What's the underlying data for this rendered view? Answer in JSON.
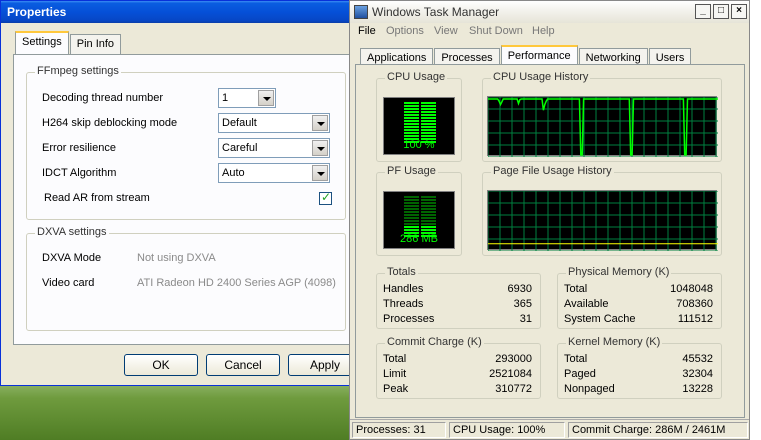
{
  "properties": {
    "title": "Properties",
    "tabs": [
      {
        "label": "Settings",
        "active": true
      },
      {
        "label": "Pin Info",
        "active": false
      }
    ],
    "ffmpeg": {
      "legend": "FFmpeg settings",
      "rows": [
        {
          "label": "Decoding thread number",
          "value": "1"
        },
        {
          "label": "H264 skip deblocking mode",
          "value": "Default"
        },
        {
          "label": "Error resilience",
          "value": "Careful"
        },
        {
          "label": "IDCT Algorithm",
          "value": "Auto"
        }
      ],
      "checkbox_label": "Read AR from stream",
      "checkbox_checked": true
    },
    "dxva": {
      "legend": "DXVA settings",
      "mode_label": "DXVA Mode",
      "mode_value": "Not using DXVA",
      "card_label": "Video card",
      "card_value": "ATI Radeon HD 2400 Series AGP (4098)"
    },
    "buttons": {
      "ok": "OK",
      "cancel": "Cancel",
      "apply": "Apply"
    }
  },
  "taskmanager": {
    "title": "Windows Task Manager",
    "menu": [
      "File",
      "Options",
      "View",
      "Shut Down",
      "Help"
    ],
    "tabs": [
      {
        "label": "Applications",
        "active": false
      },
      {
        "label": "Processes",
        "active": false
      },
      {
        "label": "Performance",
        "active": true
      },
      {
        "label": "Networking",
        "active": false
      },
      {
        "label": "Users",
        "active": false
      }
    ],
    "cpu_usage": {
      "legend": "CPU Usage",
      "value_text": "100 %",
      "level": 1.0
    },
    "cpu_history": {
      "legend": "CPU Usage History",
      "series": [
        100,
        100,
        100,
        100,
        100,
        100,
        100,
        100,
        96,
        90,
        95,
        100,
        100,
        100,
        100,
        100,
        100,
        100,
        100,
        100,
        100,
        100,
        92,
        99,
        100,
        100,
        100,
        100,
        100,
        100,
        100,
        100,
        100,
        100,
        100,
        100,
        100,
        100,
        100,
        100,
        80,
        90,
        96,
        100,
        100,
        100,
        100,
        100,
        100,
        100,
        100,
        100,
        100,
        100,
        100,
        100,
        100,
        100,
        100,
        100,
        100,
        100,
        100,
        100,
        100,
        100,
        100,
        0,
        0,
        100,
        100,
        100,
        100,
        100,
        100,
        100,
        100,
        100,
        100,
        100,
        100,
        100,
        100,
        100,
        100,
        100,
        100,
        100,
        100,
        100,
        100,
        100,
        100,
        100,
        100,
        100,
        100,
        100,
        100,
        100,
        100,
        100,
        100,
        0,
        0,
        100,
        100,
        100,
        100,
        100,
        100,
        100,
        100,
        100,
        100,
        100,
        100,
        100,
        100,
        100,
        100,
        100,
        100,
        100,
        100,
        100,
        100,
        100,
        100,
        100,
        100,
        100,
        100,
        100,
        100,
        100,
        100,
        100,
        100,
        100,
        100,
        100,
        0,
        0,
        100,
        100,
        100,
        100,
        100,
        100,
        100,
        100,
        100,
        100,
        100,
        100,
        100,
        100,
        100,
        100,
        100,
        100,
        100,
        100,
        100,
        100,
        100
      ]
    },
    "pf_usage": {
      "legend": "PF Usage",
      "value_text": "286 MB",
      "level": 0.27
    },
    "pf_history": {
      "legend": "Page File Usage History"
    },
    "totals": {
      "legend": "Totals",
      "rows": [
        {
          "label": "Handles",
          "value": "6930"
        },
        {
          "label": "Threads",
          "value": "365"
        },
        {
          "label": "Processes",
          "value": "31"
        }
      ]
    },
    "physical": {
      "legend": "Physical Memory (K)",
      "rows": [
        {
          "label": "Total",
          "value": "1048048"
        },
        {
          "label": "Available",
          "value": "708360"
        },
        {
          "label": "System Cache",
          "value": "111512"
        }
      ]
    },
    "commit": {
      "legend": "Commit Charge (K)",
      "rows": [
        {
          "label": "Total",
          "value": "293000"
        },
        {
          "label": "Limit",
          "value": "2521084"
        },
        {
          "label": "Peak",
          "value": "310772"
        }
      ]
    },
    "kernel": {
      "legend": "Kernel Memory (K)",
      "rows": [
        {
          "label": "Total",
          "value": "45532"
        },
        {
          "label": "Paged",
          "value": "32304"
        },
        {
          "label": "Nonpaged",
          "value": "13228"
        }
      ]
    },
    "status": {
      "processes": "Processes: 31",
      "cpu": "CPU Usage: 100%",
      "commit": "Commit Charge: 286M / 2461M"
    },
    "colors": {
      "graph_bg": "#000000",
      "graph_grid": "#008040",
      "graph_line": "#00ff00",
      "pf_line": "#ffff00"
    }
  }
}
